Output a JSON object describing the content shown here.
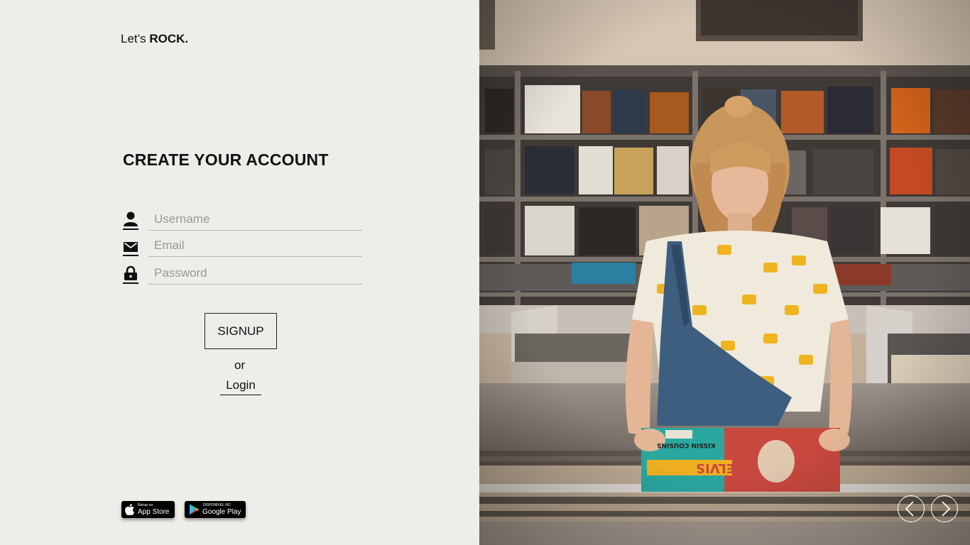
{
  "brand": {
    "prefix": "Let’s ",
    "bold": "ROCK."
  },
  "form": {
    "title": "CREATE YOUR ACCOUNT",
    "username_placeholder": "Username",
    "email_placeholder": "Email",
    "password_placeholder": "Password",
    "signup_label": "SIGNUP",
    "or_text": "or",
    "login_label": "Login"
  },
  "stores": {
    "appstore_small": "Baixar na",
    "appstore_large": "App Store",
    "googleplay_small": "DISPONÍVEL NO",
    "googleplay_large": "Google Play"
  },
  "hero": {
    "icons": [
      "chevron-left-icon",
      "chevron-right-icon"
    ],
    "album_title": "ELVIS",
    "album_subtitle": "KISSIN COUSINS"
  },
  "colors": {
    "background": "#efedea",
    "text": "#111111"
  }
}
